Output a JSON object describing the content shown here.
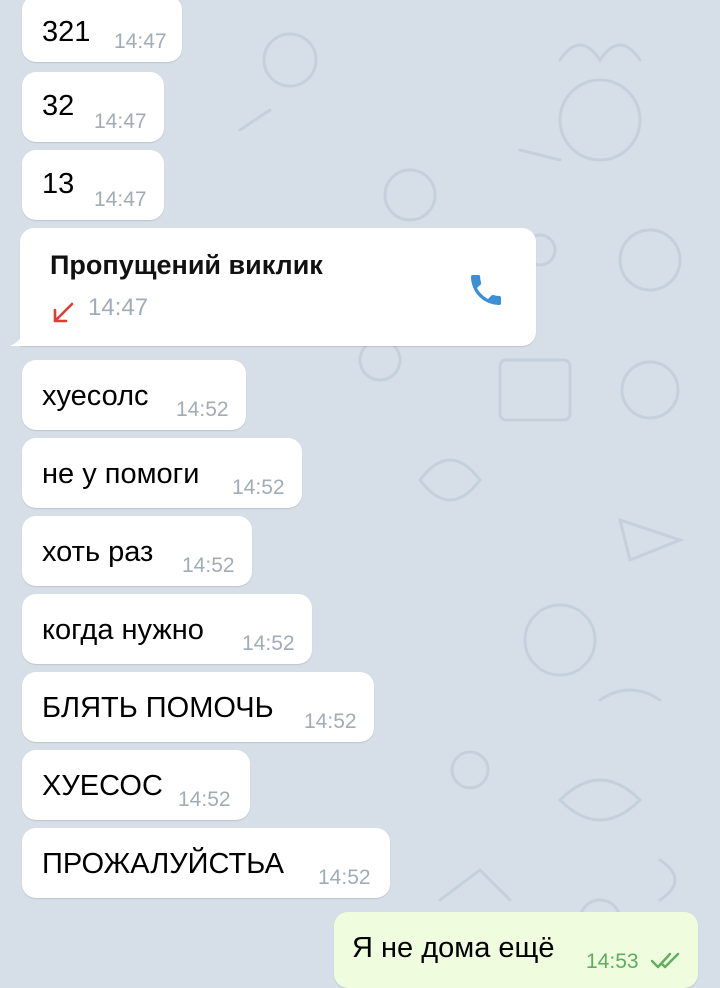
{
  "messages": [
    {
      "text": "321",
      "time": "14:47"
    },
    {
      "text": "32",
      "time": "14:47"
    },
    {
      "text": "13",
      "time": "14:47"
    },
    {
      "text": "хуесолс",
      "time": "14:52"
    },
    {
      "text": "не у помоги",
      "time": "14:52"
    },
    {
      "text": "хоть раз",
      "time": "14:52"
    },
    {
      "text": "когда нужно",
      "time": "14:52"
    },
    {
      "text": "БЛЯТЬ ПОМОЧЬ",
      "time": "14:52"
    },
    {
      "text": "ХУЕСОС",
      "time": "14:52"
    },
    {
      "text": "ПРОЖАЛУЙСТЬА",
      "time": "14:52"
    }
  ],
  "call": {
    "title": "Пропущений виклик",
    "time": "14:47",
    "status_icon": "missed-call-arrow-icon",
    "action_icon": "phone-icon"
  },
  "outgoing": {
    "text": "Я не дома ещё",
    "time": "14:53",
    "status_icon": "double-check-icon"
  },
  "colors": {
    "background": "#d6dfe8",
    "incoming_bubble": "#ffffff",
    "outgoing_bubble": "#effdde",
    "missed_arrow": "#e53935",
    "phone_icon": "#3a8fd6",
    "outgoing_time": "#5fad5f"
  }
}
